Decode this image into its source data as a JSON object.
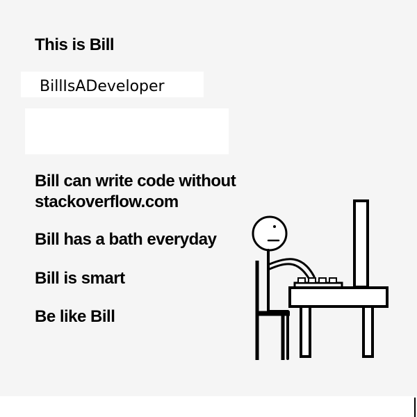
{
  "meme": {
    "title": "This is Bill",
    "name_box": "BillIsADeveloper",
    "lines": [
      "Bill can write code without",
      "stackoverflow.com",
      "Bill has a bath everyday",
      "Bill is smart",
      "Be like Bill"
    ]
  },
  "icons": {
    "figure": "stick-figure-at-computer-icon"
  }
}
